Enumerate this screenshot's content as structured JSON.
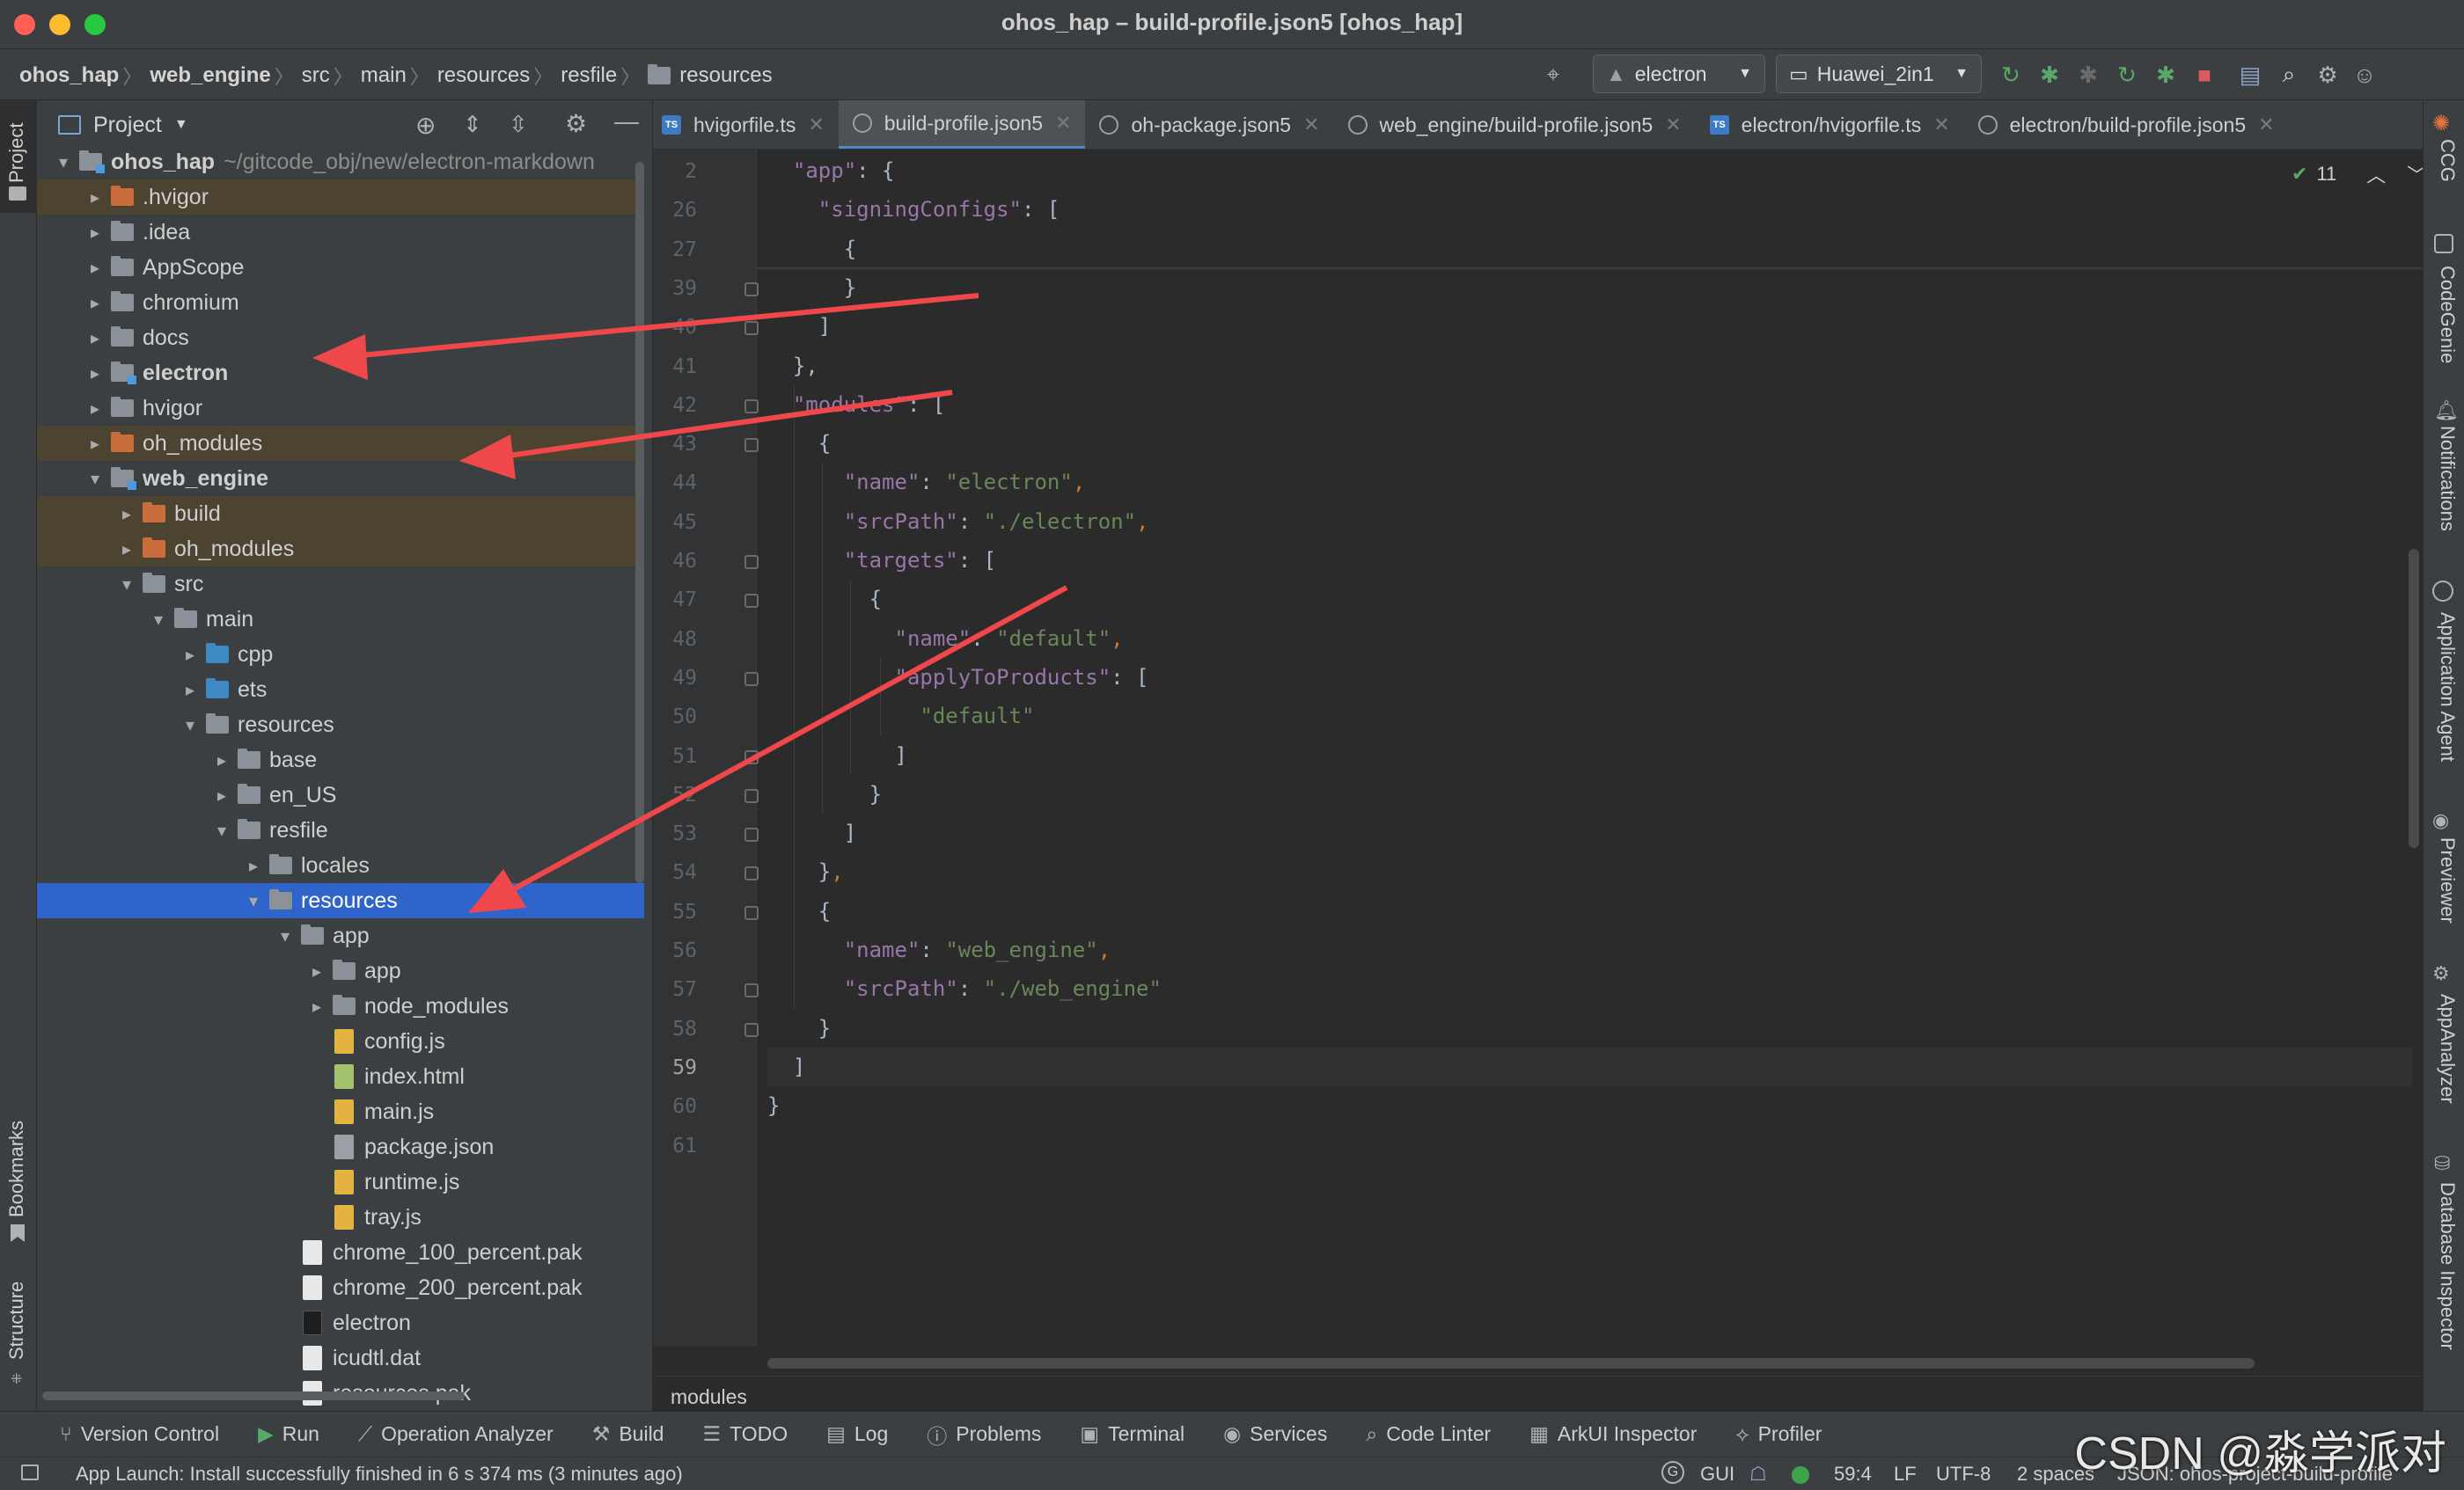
{
  "window": {
    "title": "ohos_hap – build-profile.json5 [ohos_hap]"
  },
  "breadcrumb": [
    "ohos_hap",
    "web_engine",
    "src",
    "main",
    "resources",
    "resfile",
    "resources"
  ],
  "toolbar": {
    "run_config": "electron",
    "device": "Huawei_2in1"
  },
  "project": {
    "title": "Project",
    "root_name": "ohos_hap",
    "root_path": "~/gitcode_obj/new/electron-markdown",
    "items": [
      ".hvigor",
      ".idea",
      "AppScope",
      "chromium",
      "docs",
      "electron",
      "hvigor",
      "oh_modules",
      "web_engine",
      "build",
      "oh_modules",
      "src",
      "main",
      "cpp",
      "ets",
      "resources",
      "base",
      "en_US",
      "resfile",
      "locales",
      "resources",
      "app",
      "app",
      "node_modules",
      "config.js",
      "index.html",
      "main.js",
      "package.json",
      "runtime.js",
      "tray.js",
      "chrome_100_percent.pak",
      "chrome_200_percent.pak",
      "electron",
      "icudtl.dat",
      "resources.pak"
    ]
  },
  "tabs": [
    "hvigorfile.ts",
    "build-profile.json5",
    "oh-package.json5",
    "web_engine/build-profile.json5",
    "electron/hvigorfile.ts",
    "electron/build-profile.json5"
  ],
  "inspection": {
    "count": "11"
  },
  "editor": {
    "line_numbers": [
      "2",
      "26",
      "27",
      "39",
      "40",
      "41",
      "42",
      "43",
      "44",
      "45",
      "46",
      "47",
      "48",
      "49",
      "50",
      "51",
      "52",
      "53",
      "54",
      "55",
      "56",
      "57",
      "58",
      "59",
      "60",
      "61"
    ],
    "lines": [
      [
        [
          "p",
          "  "
        ],
        [
          "k",
          "\"app\""
        ],
        [
          "p",
          ": {"
        ]
      ],
      [
        [
          "p",
          "    "
        ],
        [
          "k",
          "\"signingConfigs\""
        ],
        [
          "p",
          ": ["
        ]
      ],
      [
        [
          "p",
          "      {"
        ]
      ],
      [
        [
          "p",
          "      }"
        ]
      ],
      [
        [
          "p",
          "    ]"
        ]
      ],
      [
        [
          "p",
          "  },"
        ]
      ],
      [
        [
          "p",
          "  "
        ],
        [
          "k",
          "\"modules\""
        ],
        [
          "p",
          ": ["
        ]
      ],
      [
        [
          "p",
          "    {"
        ]
      ],
      [
        [
          "p",
          "      "
        ],
        [
          "k",
          "\"name\""
        ],
        [
          "p",
          ": "
        ],
        [
          "s",
          "\"electron\""
        ],
        [
          "c",
          ","
        ]
      ],
      [
        [
          "p",
          "      "
        ],
        [
          "k",
          "\"srcPath\""
        ],
        [
          "p",
          ": "
        ],
        [
          "s",
          "\"./electron\""
        ],
        [
          "c",
          ","
        ]
      ],
      [
        [
          "p",
          "      "
        ],
        [
          "k",
          "\"targets\""
        ],
        [
          "p",
          ": ["
        ]
      ],
      [
        [
          "p",
          "        {"
        ]
      ],
      [
        [
          "p",
          "          "
        ],
        [
          "k",
          "\"name\""
        ],
        [
          "p",
          ": "
        ],
        [
          "s",
          "\"default\""
        ],
        [
          "c",
          ","
        ]
      ],
      [
        [
          "p",
          "          "
        ],
        [
          "k",
          "\"applyToProducts\""
        ],
        [
          "p",
          ": ["
        ]
      ],
      [
        [
          "p",
          "            "
        ],
        [
          "s",
          "\"default\""
        ]
      ],
      [
        [
          "p",
          "          ]"
        ]
      ],
      [
        [
          "p",
          "        }"
        ]
      ],
      [
        [
          "p",
          "      ]"
        ]
      ],
      [
        [
          "p",
          "    }"
        ],
        [
          "c",
          ","
        ]
      ],
      [
        [
          "p",
          "    {"
        ]
      ],
      [
        [
          "p",
          "      "
        ],
        [
          "k",
          "\"name\""
        ],
        [
          "p",
          ": "
        ],
        [
          "s",
          "\"web_engine\""
        ],
        [
          "c",
          ","
        ]
      ],
      [
        [
          "p",
          "      "
        ],
        [
          "k",
          "\"srcPath\""
        ],
        [
          "p",
          ": "
        ],
        [
          "s",
          "\"./web_engine\""
        ]
      ],
      [
        [
          "p",
          "    }"
        ]
      ],
      [
        [
          "p",
          "  ]"
        ]
      ],
      [
        [
          "p",
          "}"
        ]
      ],
      [
        [
          "p",
          ""
        ]
      ]
    ],
    "breadcrumb_bottom": "modules"
  },
  "left_strip": [
    "Project",
    "Bookmarks",
    "Structure"
  ],
  "right_strip": [
    "CCG",
    "CodeGenie",
    "Notifications",
    "Application Agent",
    "Previewer",
    "AppAnalyzer",
    "Database Inspector"
  ],
  "toolwindows": [
    "Version Control",
    "Run",
    "Operation Analyzer",
    "Build",
    "TODO",
    "Log",
    "Problems",
    "Terminal",
    "Services",
    "Code Linter",
    "ArkUI Inspector",
    "Profiler"
  ],
  "status": {
    "message": "App Launch: Install successfully finished in 6 s 374 ms (3 minutes ago)",
    "gui": "GUI",
    "position": "59:4",
    "line_sep": "LF",
    "encoding": "UTF-8",
    "indent": "2 spaces",
    "schema": "JSON: ohos-project-build-profile"
  },
  "watermark": "CSDN @淼学派对",
  "colors": {
    "folder": "#8a9199",
    "excluded_folder": "#c86d3b",
    "source_folder": "#3d8ac2",
    "selection": "#2f65ca",
    "annotation_arrow": "#f0484a"
  }
}
